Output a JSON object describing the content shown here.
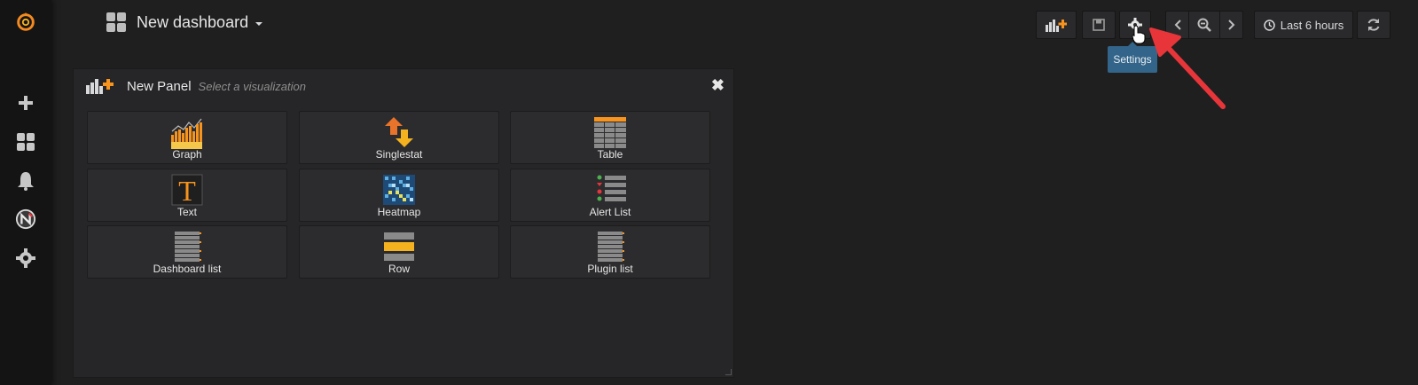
{
  "sidebar": {
    "icons": [
      "grafana-logo-icon",
      "plus-icon",
      "dashboards-icon",
      "bell-icon",
      "user-avatar-icon",
      "gear-icon"
    ]
  },
  "header": {
    "title": "New dashboard",
    "time_range": "Last 6 hours",
    "tooltip": "Settings"
  },
  "panel": {
    "title": "New Panel",
    "subtitle": "Select a visualization",
    "visualizations": [
      {
        "label": "Graph"
      },
      {
        "label": "Singlestat"
      },
      {
        "label": "Table"
      },
      {
        "label": "Text"
      },
      {
        "label": "Heatmap"
      },
      {
        "label": "Alert List"
      },
      {
        "label": "Dashboard list"
      },
      {
        "label": "Row"
      },
      {
        "label": "Plugin list"
      }
    ]
  },
  "colors": {
    "accent_orange": "#f7941e",
    "tooltip_blue": "#33658a",
    "arrow_red": "#e8353a"
  }
}
